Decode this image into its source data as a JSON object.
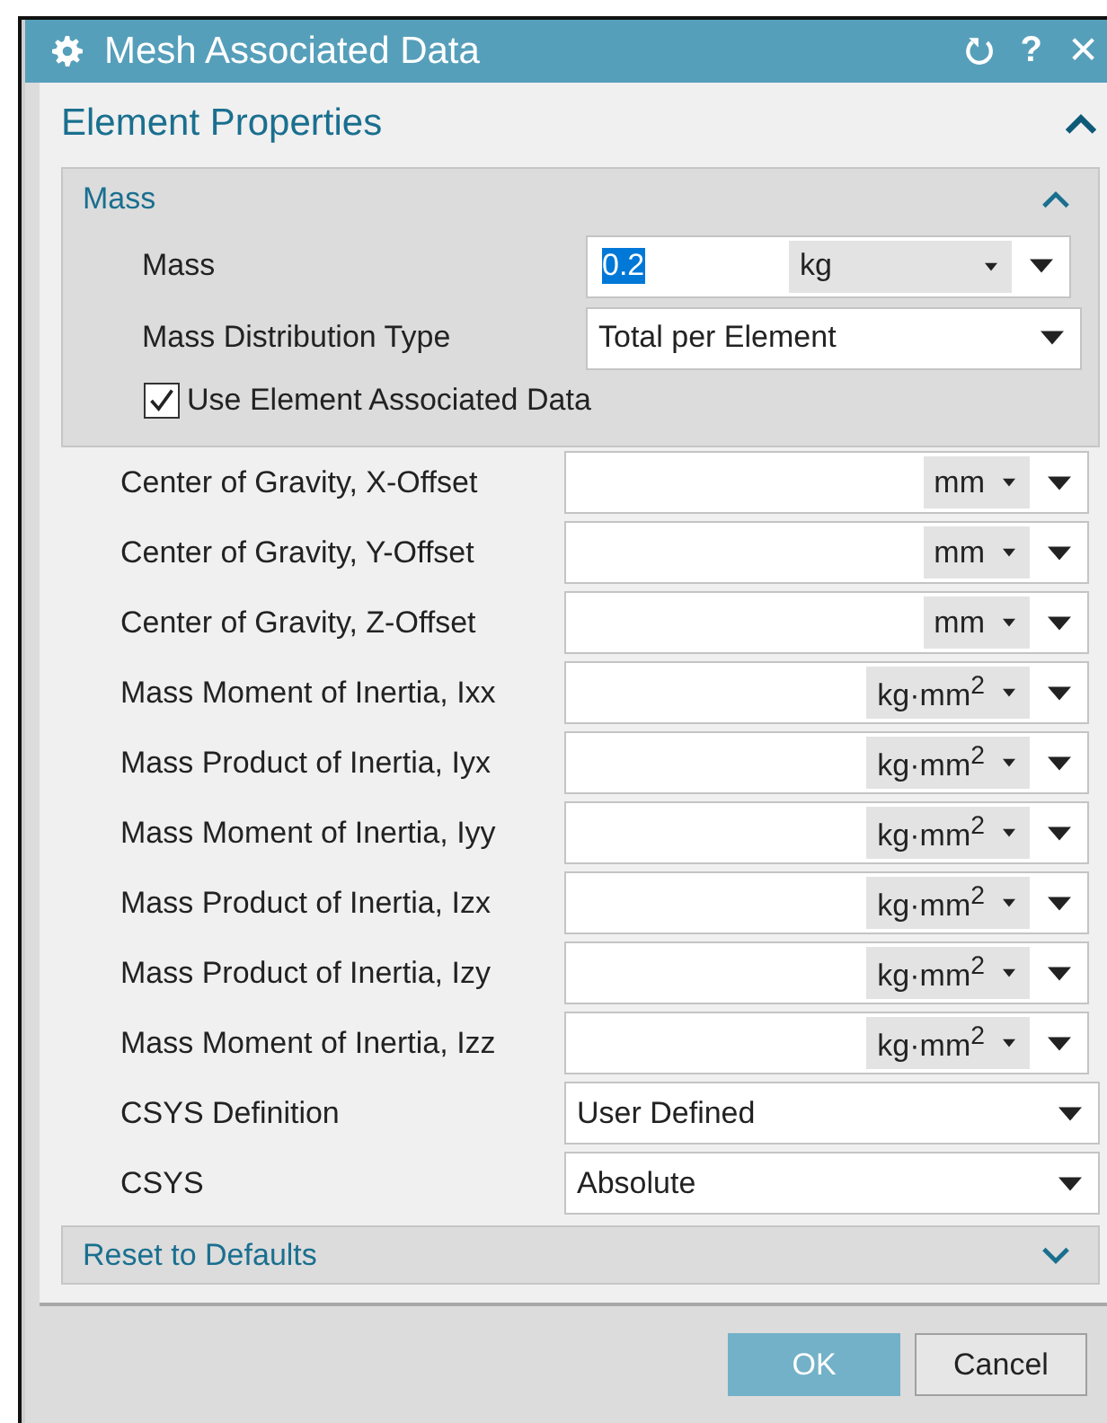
{
  "window": {
    "title": "Mesh Associated Data",
    "help": "?",
    "close": "✕"
  },
  "section": {
    "title": "Element Properties",
    "expanded": true,
    "mass_group": {
      "title": "Mass",
      "expanded": true,
      "fields": [
        {
          "label": "Mass",
          "kind": "unit_input",
          "value": "0.2",
          "value_selected": true,
          "unit": "kg"
        },
        {
          "label": "Mass Distribution Type",
          "kind": "select",
          "value": "Total per Element"
        }
      ],
      "checkbox": {
        "label": "Use Element Associated Data",
        "checked": true
      }
    },
    "fields": [
      {
        "label": "Center of Gravity, X-Offset",
        "kind": "unit_input",
        "unit": "mm"
      },
      {
        "label": "Center of Gravity, Y-Offset",
        "kind": "unit_input",
        "unit": "mm"
      },
      {
        "label": "Center of Gravity, Z-Offset",
        "kind": "unit_input",
        "unit": "mm"
      },
      {
        "label": "Mass Moment of Inertia, Ixx",
        "kind": "unit_input",
        "unit": "kg·mm$^{2}$"
      },
      {
        "label": "Mass Product of Inertia, Iyx",
        "kind": "unit_input",
        "unit": "kg·mm$^{2}$"
      },
      {
        "label": "Mass Moment of Inertia, Iyy",
        "kind": "unit_input",
        "unit": "kg·mm$^{2}$"
      },
      {
        "label": "Mass Product of Inertia, Izx",
        "kind": "unit_input",
        "unit": "kg·mm$^{2}$"
      },
      {
        "label": "Mass Product of Inertia, Izy",
        "kind": "unit_input",
        "unit": "kg·mm$^{2}$"
      },
      {
        "label": "Mass Moment of Inertia, Izz",
        "kind": "unit_input",
        "unit": "kg·mm$^{2}$"
      },
      {
        "label": "CSYS Definition",
        "kind": "select",
        "value": "User Defined"
      },
      {
        "label": "CSYS",
        "kind": "select",
        "value": "Absolute"
      }
    ],
    "reset_group": {
      "title": "Reset to Defaults",
      "expanded": false
    }
  },
  "buttons": [
    {
      "label": "OK",
      "kind": "primary"
    },
    {
      "label": "Cancel",
      "kind": "secondary"
    }
  ]
}
